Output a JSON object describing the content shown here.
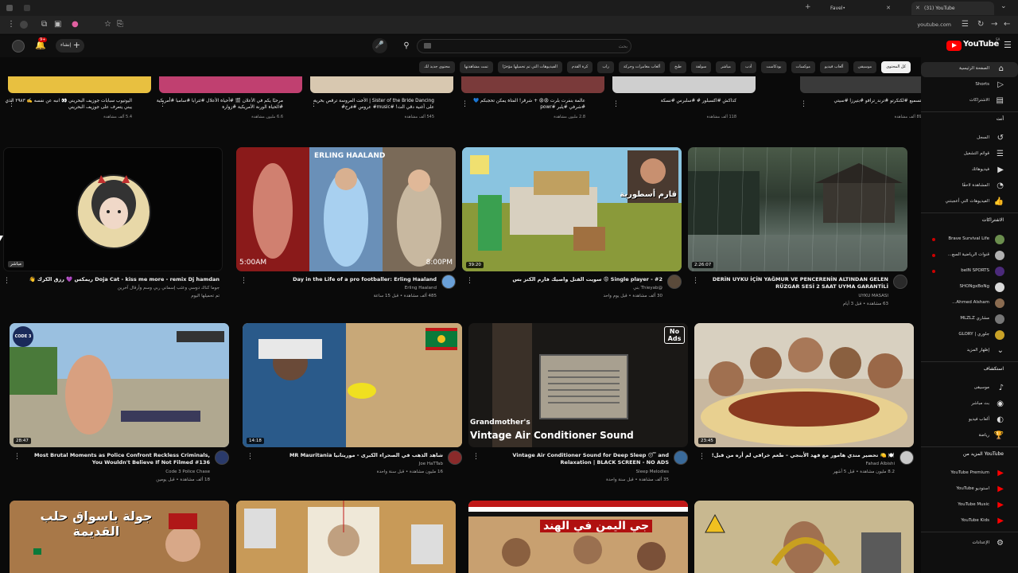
{
  "browser": {
    "tabs": [
      {
        "title": "(31) YouTube",
        "active": true
      },
      {
        "title": "Favel•",
        "active": false
      }
    ],
    "url": "youtube.com"
  },
  "header": {
    "search_placeholder": "بحث",
    "create_label": "إنشاء",
    "notification_count": "9+",
    "logo_text": "YouTube",
    "country_code": "SA"
  },
  "chips": [
    {
      "label": "كل المحتوى",
      "active": true
    },
    {
      "label": "موسيقى"
    },
    {
      "label": "ألعاب فيديو"
    },
    {
      "label": "موكسات"
    },
    {
      "label": "بودكاست"
    },
    {
      "label": "أدب"
    },
    {
      "label": "مباشر"
    },
    {
      "label": "سولفة"
    },
    {
      "label": "طبخ"
    },
    {
      "label": "ألعاب مغامرات وحركة"
    },
    {
      "label": "راب"
    },
    {
      "label": "كرة القدم"
    },
    {
      "label": "الفيديوهات التي تم تحميلها مؤخرًا"
    },
    {
      "label": "تمت مشاهدتها"
    },
    {
      "label": "محتوى جديد لك"
    }
  ],
  "sidebar": {
    "main": [
      {
        "label": "الصفحة الرئيسية",
        "icon": "home-icon",
        "active": true
      },
      {
        "label": "Shorts",
        "icon": "shorts-icon"
      },
      {
        "label": "الاشتراكات",
        "icon": "subscriptions-icon"
      }
    ],
    "you_header": "أنت",
    "you": [
      {
        "label": "السجل",
        "icon": "history-icon"
      },
      {
        "label": "قوائم التشغيل",
        "icon": "playlist-icon"
      },
      {
        "label": "فيديوهاتك",
        "icon": "your-videos-icon"
      },
      {
        "label": "المشاهدة لاحقًا",
        "icon": "watch-later-icon"
      },
      {
        "label": "الفيديوهات التي أعجبتني",
        "icon": "like-icon"
      }
    ],
    "subs_header": "الاشتراكات",
    "subs": [
      {
        "label": "Brave Survival Life",
        "color": "#6b8e4e",
        "live": true
      },
      {
        "label": "قنوات الرياضية السع...",
        "color": "#b0b0b0",
        "live": true
      },
      {
        "label": "beIN SPORTS",
        "color": "#4b2a7a",
        "live": true
      },
      {
        "label": "SHONgxBoNg",
        "color": "#d8d8d8",
        "live": false
      },
      {
        "label": "Ahmed Alsham...",
        "color": "#8a6b50",
        "live": false
      },
      {
        "label": "مشاري MLZLZ",
        "color": "#777777",
        "live": false
      },
      {
        "label": "جلوري | GLORY",
        "color": "#c9a227",
        "live": false
      }
    ],
    "show_more": "إظهار المزيد",
    "explore_header": "استكشاف",
    "explore": [
      {
        "label": "موسيقى",
        "icon": "music-icon"
      },
      {
        "label": "بث مباشر",
        "icon": "live-icon"
      },
      {
        "label": "ألعاب فيديو",
        "icon": "gaming-icon"
      },
      {
        "label": "رياضة",
        "icon": "trophy-icon"
      }
    ],
    "more_header": "المزيد من YouTube",
    "more": [
      {
        "label": "YouTube Premium"
      },
      {
        "label": "استوديو YouTube"
      },
      {
        "label": "YouTube Music"
      },
      {
        "label": "YouTube Kids"
      }
    ],
    "settings_label": "الإعدادات"
  },
  "top_row": [
    {
      "title": "التسميع #لكنكرتو #ترند_ترافو #بتيرزا #سيتي",
      "meta": "891 ألف مشاهدة",
      "color": "#3a3a3a"
    },
    {
      "title": "كذاكش #اكسبلور # #سلبرس #نسكة",
      "meta": "118 ألف مشاهدة",
      "color": "#cfcfcf"
    },
    {
      "title": "عالمة بنفرت بلرت 😡😡 + شرقر! الفتاة يمكن تحجبكم 💙 #شرفي #يلبر #powr",
      "meta": "2.8 مليون مشاهدة",
      "color": "#7a3a3a"
    },
    {
      "title": "Sister of the Bride Dancing | الأخت العروسة ترقص بخرية على أغنية دقي الت! #music# عروس #فرح#",
      "meta": "545 ألف مشاهدة",
      "color": "#d8c8b0"
    },
    {
      "title": "مرحبًا يكم في الأعلان 🎬 #أحياة الأعلال #ثترابا #سامبا #أمريكية #الحياة الورنة الأمريكية #زوارة",
      "meta": "6.6 مليون مشاهدة",
      "color": "#c04070"
    },
    {
      "title": "اليوتيوب سبابات جوزيف البحريني 👀 انبه عن نفسه ✍️ ٢٩٨٣ الذي يبني يتعرف على جوزيف البحريني",
      "meta": "5.4 ألف مشاهدة",
      "color": "#e8c040"
    }
  ],
  "videos": [
    {
      "title": "DERİN UYKU İÇİN YAĞMUR VE PENCERENİN ALTINDAN GELEN RÜZGAR SESİ 2 SAAT UYMA GARANTİLİ",
      "channel": "UYKU MASASI",
      "meta": "63 مشاهدة • قبل 3 أيام",
      "duration": "2:26:07",
      "thumb": "rain",
      "avatar_color": "#2a2a2a"
    },
    {
      "title": "Single player - #2 😡 سويت القتل واصيك فارم الكنز بس",
      "channel": "@Thieyab بني",
      "meta": "30 ألف مشاهدة • قبل يوم واحد",
      "duration": "39:20",
      "thumb": "minecraft",
      "thumb_caption": "قارم أسطورية",
      "avatar_color": "#5a4a3a"
    },
    {
      "title": "Day in the Life of a pro footballer: Erling Haaland",
      "channel": "Erling Haaland",
      "meta": "485 ألف مشاهدة • قبل 15 ساعة",
      "duration": "",
      "thumb": "haaland",
      "thumb_caption": "ERLING HAALAND",
      "thumb_time_a": "5:00AM",
      "thumb_time_b": "8:00PM",
      "avatar_color": "#6aa0d8"
    },
    {
      "title": "Doja Cat - kiss me more - remix Dj hamdan ريمكس 💜 رزق الكرك 👋",
      "channel": "جوما كناك دوسي وعثب إسماني ربي وسم وأرقال آخرين",
      "meta": "تم تحميلها اليوم",
      "duration": "",
      "live": "مباشر",
      "thumb": "doja",
      "avatar_color": "#333"
    },
    {
      "title": "🍽️ 🍋 تحضير مندي هامور مع فهد الأبنجي – طعم خرافي لم أره من قبل!",
      "channel": "Fahad Albishi",
      "meta": "8.2 مليون مشاهدة • قبل 5 أشهر",
      "duration": "23:45",
      "thumb": "food",
      "avatar_color": "#c9c9c9"
    },
    {
      "title": "Vintage Air Conditioner Sound for Deep Sleep 😴 and Relaxation | BLACK SCREEN - NO ADS",
      "channel": "Sleep Melodies",
      "meta": "35 ألف مشاهدة • قبل سنة واحدة",
      "duration": "",
      "thumb": "ac",
      "thumb_caption_top": "Grandmother's",
      "thumb_caption": "Vintage Air Conditioner Sound",
      "thumb_badge": "No Ads",
      "avatar_color": "#3a6a9a"
    },
    {
      "title": "شاهد الذهب في الصحراء الكبرى - موريتانيا MR Mauritania",
      "channel": "Joe HaTTab",
      "meta": "16 مليون مشاهدة • قبل سنة واحدة",
      "duration": "14:18",
      "thumb": "mauritania",
      "avatar_color": "#8a2a2a"
    },
    {
      "title": "Most Brutal Moments as Police Confront Reckless Criminals, You Wouldn't Believe If Not Filmed #136",
      "channel": "Code 3 Police Chase",
      "meta": "18 ألف مشاهدة • قبل يومين",
      "duration": "28:47",
      "thumb": "police",
      "thumb_badge": "CODE 3",
      "avatar_color": "#2a3a6a"
    }
  ],
  "bottom_row": [
    {
      "thumb": "snake",
      "color": "#c8b890"
    },
    {
      "thumb": "yemen",
      "caption": "جي اليمن في الهند",
      "color": "#c8a070"
    },
    {
      "thumb": "osama",
      "color": "#d8b070"
    },
    {
      "thumb": "aleppo",
      "caption": "جولة باسواق حلب القديمة",
      "color": "#c89050"
    }
  ]
}
